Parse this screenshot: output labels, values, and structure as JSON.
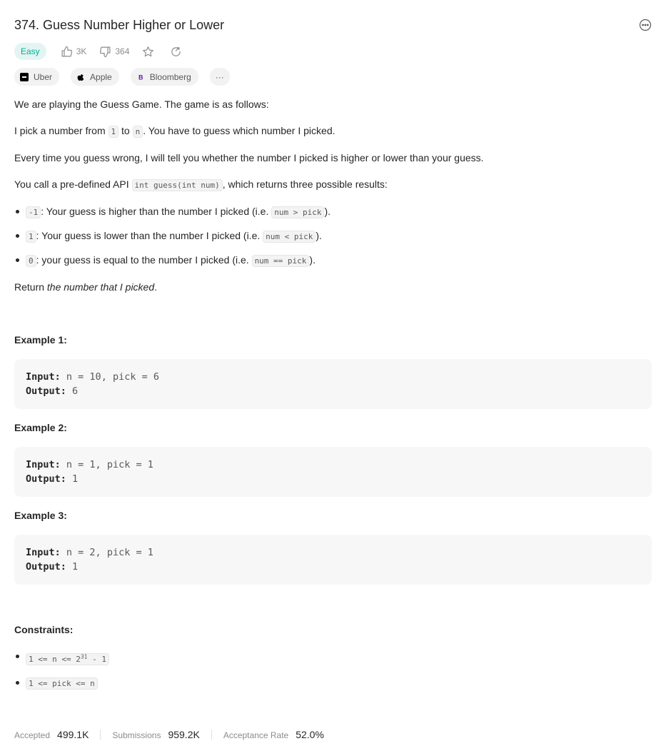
{
  "problem": {
    "title": "374. Guess Number Higher or Lower",
    "difficulty": "Easy",
    "likes": "3K",
    "dislikes": "364"
  },
  "tags": [
    {
      "name": "Uber",
      "icon": "uber-logo-icon"
    },
    {
      "name": "Apple",
      "icon": "apple-logo-icon"
    },
    {
      "name": "Bloomberg",
      "icon": "bloomberg-logo-icon"
    }
  ],
  "tags_more": "···",
  "description": {
    "p1": "We are playing the Guess Game. The game is as follows:",
    "p2_before": "I pick a number from ",
    "p2_code1": "1",
    "p2_mid": " to ",
    "p2_code2": "n",
    "p2_after": ". You have to guess which number I picked.",
    "p3": "Every time you guess wrong, I will tell you whether the number I picked is higher or lower than your guess.",
    "p4_before": "You call a pre-defined API ",
    "p4_code": "int guess(int num)",
    "p4_after": ", which returns three possible results:",
    "results": [
      {
        "code": "-1",
        "text": ": Your guess is higher than the number I picked (i.e. ",
        "code2": "num > pick",
        "end": ")."
      },
      {
        "code": "1",
        "text": ": Your guess is lower than the number I picked (i.e. ",
        "code2": "num < pick",
        "end": ")."
      },
      {
        "code": "0",
        "text": ": your guess is equal to the number I picked (i.e. ",
        "code2": "num == pick",
        "end": ")."
      }
    ],
    "return_before": "Return ",
    "return_em": "the number that I picked",
    "return_after": "."
  },
  "examples": [
    {
      "title": "Example 1:",
      "input_label": "Input:",
      "input": "n = 10, pick = 6",
      "output_label": "Output:",
      "output": "6"
    },
    {
      "title": "Example 2:",
      "input_label": "Input:",
      "input": "n = 1, pick = 1",
      "output_label": "Output:",
      "output": "1"
    },
    {
      "title": "Example 3:",
      "input_label": "Input:",
      "input": "n = 2, pick = 1",
      "output_label": "Output:",
      "output": "1"
    }
  ],
  "constraints": {
    "title": "Constraints:",
    "c1_before": "1 <= n <= 2",
    "c1_sup": "31",
    "c1_after": " - 1",
    "c2": "1 <= pick <= n"
  },
  "stats": {
    "accepted_label": "Accepted",
    "accepted": "499.1K",
    "submissions_label": "Submissions",
    "submissions": "959.2K",
    "rate_label": "Acceptance Rate",
    "rate": "52.0%"
  },
  "colors": {
    "easy_text": "#00af9b",
    "easy_bg": "#e3f5f2",
    "code_bg": "#f7f7f8"
  }
}
